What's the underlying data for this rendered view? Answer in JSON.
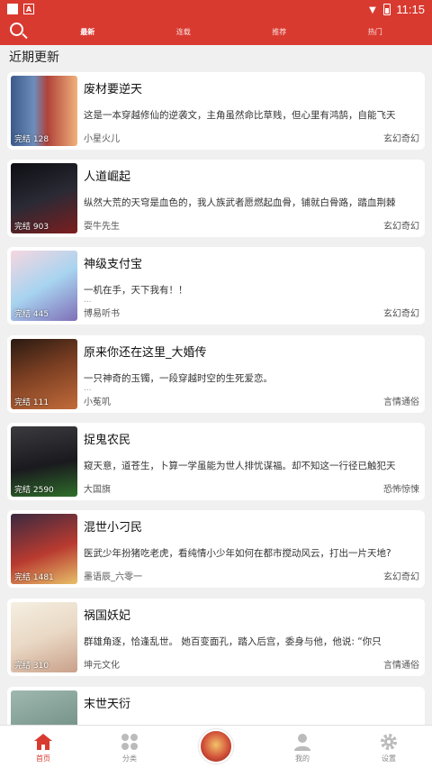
{
  "status_bar": {
    "time": "11:15"
  },
  "nav": {
    "tabs": [
      "最新",
      "连载",
      "推荐",
      "热门"
    ]
  },
  "section_title": "近期更新",
  "books": [
    {
      "title": "废材要逆天",
      "desc": "这是一本穿越修仙的逆袭文，主角虽然命比草贱，但心里有鸿鹄，自能飞天",
      "ellipsis": "",
      "author": "小星火儿",
      "genre": "玄幻奇幻",
      "badge": "完结 128"
    },
    {
      "title": "人道崛起",
      "desc": "纵然大荒的天穹是血色的，我人族武者愿燃起血骨，铺就白骨路，踏血荆棘",
      "ellipsis": "",
      "author": "耍牛先生",
      "genre": "玄幻奇幻",
      "badge": "完结 903"
    },
    {
      "title": "神级支付宝",
      "desc": "一机在手，天下我有！！",
      "ellipsis": "...",
      "author": "博易听书",
      "genre": "玄幻奇幻",
      "badge": "完结 445"
    },
    {
      "title": "原来你还在这里_大婚传",
      "desc": " 一只神奇的玉镯，一段穿越时空的生死爱恋。",
      "ellipsis": "...",
      "author": "小菟叽",
      "genre": "言情通俗",
      "badge": "完结 111"
    },
    {
      "title": "捉鬼农民",
      "desc": "窥天意，道苍生，卜算一学虽能为世人排忧谋福。却不知这一行径已触犯天",
      "ellipsis": "",
      "author": "大国旗",
      "genre": "恐怖惊悚",
      "badge": "完结 2590"
    },
    {
      "title": "混世小刁民",
      "desc": "医武少年扮猪吃老虎，看纯情小少年如何在都市搅动风云，打出一片天地?",
      "ellipsis": "",
      "author": "墨语辰_六零一",
      "genre": "玄幻奇幻",
      "badge": "完结 1481"
    },
    {
      "title": "祸国妖妃",
      "desc": "群雄角逐，恰逢乱世。 她百变面孔，踏入后宫，委身与他，他说: “你只",
      "ellipsis": "",
      "author": "坤元文化",
      "genre": "言情通俗",
      "badge": "完结 310"
    },
    {
      "title": "末世天衍",
      "desc": "",
      "ellipsis": "",
      "author": "",
      "genre": "",
      "badge": ""
    }
  ],
  "bottom_nav": [
    "首页",
    "分类",
    "",
    "我的",
    "设置"
  ],
  "colors": {
    "accent": "#d93a30"
  }
}
